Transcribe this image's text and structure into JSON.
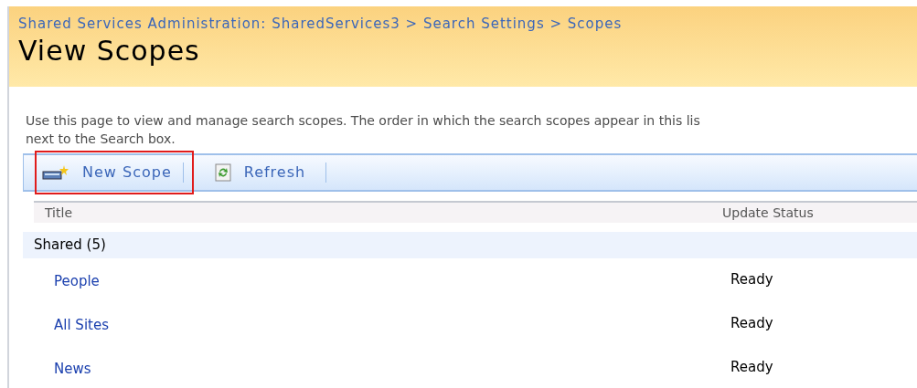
{
  "breadcrumb": "Shared Services Administration: SharedServices3 > Search Settings > Scopes",
  "title": "View Scopes",
  "description": [
    "Use this page to view and manage search scopes. The order in which the search scopes appear in this lis",
    "next to the Search box."
  ],
  "toolbar": [
    {
      "kind": "new",
      "label": "New Scope",
      "highlighted": true
    },
    {
      "kind": "refresh",
      "label": "Refresh",
      "highlighted": false
    }
  ],
  "table": {
    "columns": [
      "Title",
      "Update Status"
    ],
    "group": "Shared (5)",
    "rows": [
      {
        "title": "People",
        "status": "Ready"
      },
      {
        "title": "All Sites",
        "status": "Ready"
      },
      {
        "title": "News",
        "status": "Ready"
      }
    ]
  }
}
